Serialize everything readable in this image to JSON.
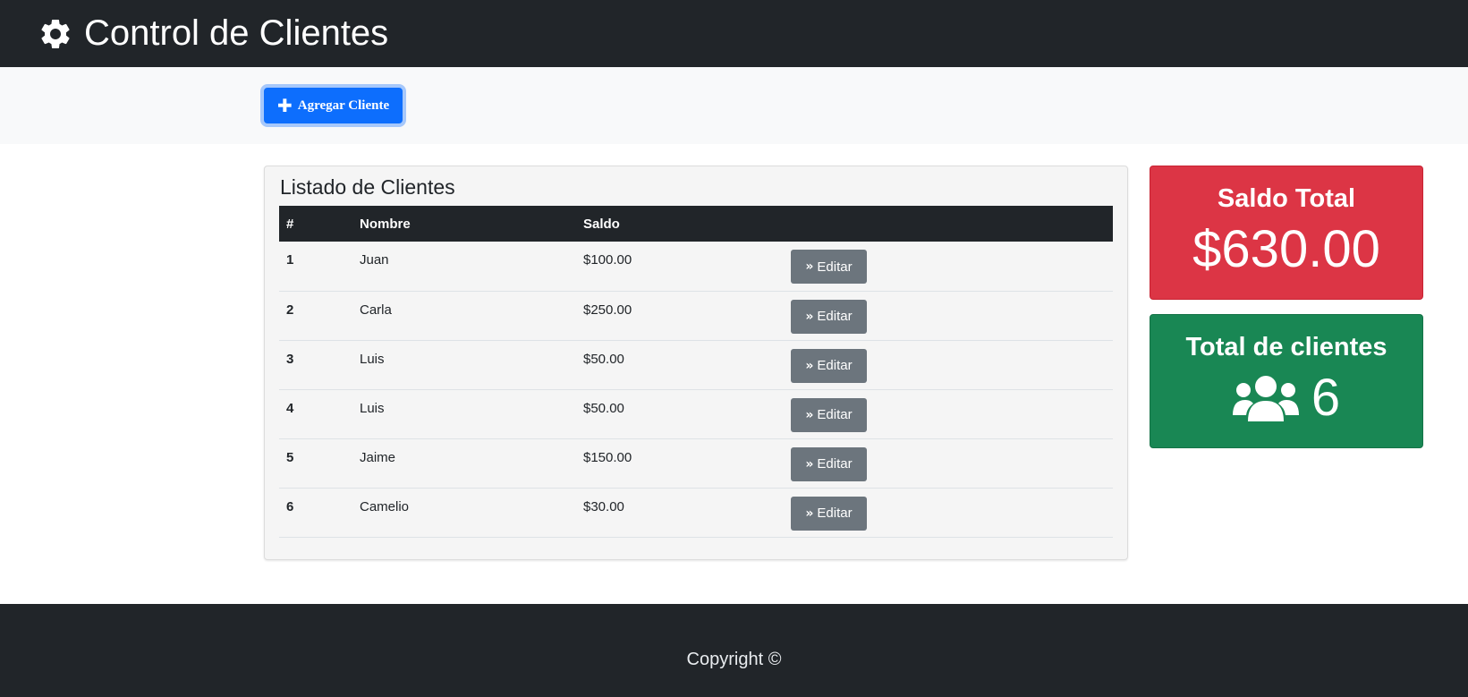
{
  "header": {
    "title": "Control de Clientes",
    "icon": "gear-icon"
  },
  "actions": {
    "add_label": "Agregar Cliente",
    "add_icon": "plus-icon",
    "accent": "#0d6efd"
  },
  "clients_card": {
    "title": "Listado de Clientes",
    "columns": [
      "#",
      "Nombre",
      "Saldo",
      ""
    ],
    "edit_label": "Editar",
    "rows": [
      {
        "num": "1",
        "name": "Juan",
        "saldo": "$100.00"
      },
      {
        "num": "2",
        "name": "Carla",
        "saldo": "$250.00"
      },
      {
        "num": "3",
        "name": "Luis",
        "saldo": "$50.00"
      },
      {
        "num": "4",
        "name": "Luis",
        "saldo": "$50.00"
      },
      {
        "num": "5",
        "name": "Jaime",
        "saldo": "$150.00"
      },
      {
        "num": "6",
        "name": "Camelio",
        "saldo": "$30.00"
      }
    ]
  },
  "saldo_total": {
    "title": "Saldo Total",
    "value": "$630.00",
    "color": "#dc3545"
  },
  "total_clientes": {
    "title": "Total de clientes",
    "value": "6",
    "icon": "users-icon",
    "color": "#198754"
  },
  "footer": {
    "copyright": "Copyright ©"
  }
}
